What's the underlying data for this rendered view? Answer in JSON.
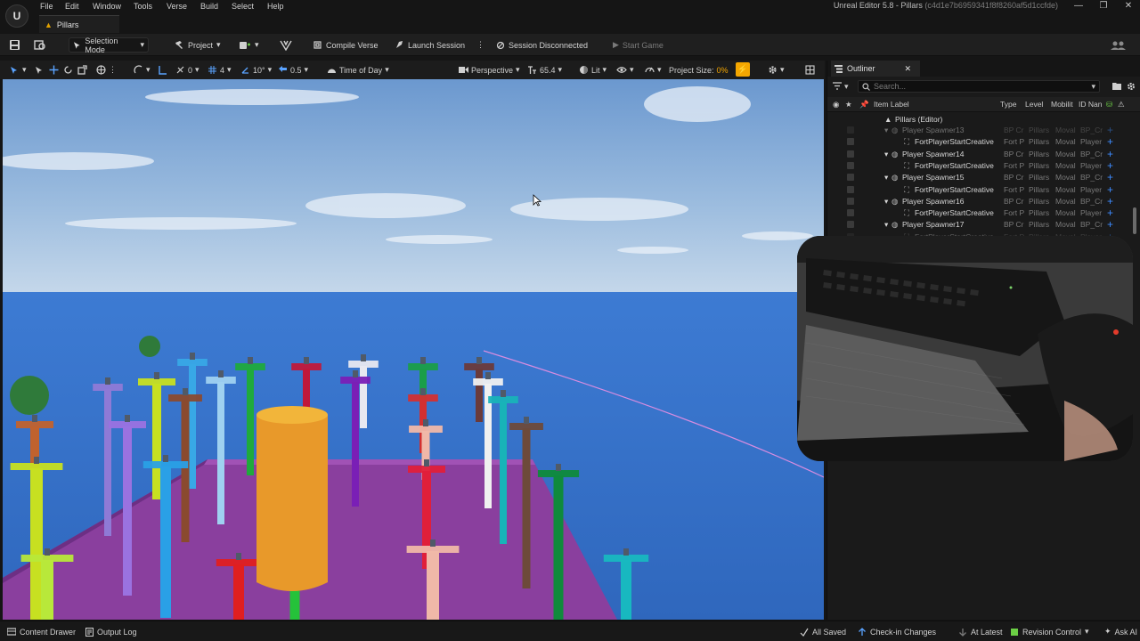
{
  "window": {
    "title": "Unreal Editor 5.8 - Pillars",
    "hash": "(c4d1e7b6959341f8f8260af5d1ccfde)",
    "controls": [
      "—",
      "❐",
      "✕"
    ]
  },
  "menu": [
    "File",
    "Edit",
    "Window",
    "Tools",
    "Verse",
    "Build",
    "Select",
    "Help"
  ],
  "doc_tab": "Pillars",
  "toolbar": {
    "selection_mode": "Selection Mode",
    "project": "Project",
    "compile_verse": "Compile Verse",
    "launch_session": "Launch Session",
    "session_status": "Session Disconnected",
    "start_game": "Start Game"
  },
  "viewport_toolbar": {
    "rot_snap": "0",
    "grid_count": "4",
    "angle_snap": "10°",
    "scale_snap": "0.5",
    "time_of_day": "Time of Day",
    "perspective": "Perspective",
    "fov": "65.4",
    "lit": "Lit",
    "project_size_label": "Project Size:",
    "project_size_value": "0%"
  },
  "outliner": {
    "tab": "Outliner",
    "search_placeholder": "Search...",
    "columns": [
      "Item Label",
      "Type",
      "Level",
      "Mobilit",
      "ID Nan"
    ],
    "root": "Pillars (Editor)",
    "rows": [
      {
        "label": "Player Spawner13",
        "indent": 1,
        "partial": true
      },
      {
        "label": "FortPlayerStartCreative",
        "indent": 2
      },
      {
        "label": "Player Spawner14",
        "indent": 1
      },
      {
        "label": "FortPlayerStartCreative",
        "indent": 2
      },
      {
        "label": "Player Spawner15",
        "indent": 1
      },
      {
        "label": "FortPlayerStartCreative",
        "indent": 2
      },
      {
        "label": "Player Spawner16",
        "indent": 1
      },
      {
        "label": "FortPlayerStartCreative",
        "indent": 2
      },
      {
        "label": "Player Spawner17",
        "indent": 1
      },
      {
        "label": "FortPlayerStartCreative",
        "indent": 2,
        "partial": true
      }
    ],
    "cells": {
      "spawner": [
        "BP Cr",
        "Pillars",
        "Moval",
        "BP_Cr"
      ],
      "start": [
        "Fort P",
        "Pillars",
        "Moval",
        "Player"
      ]
    }
  },
  "status_bar": {
    "content_drawer": "Content Drawer",
    "output_log": "Output Log",
    "all_saved": "All Saved",
    "check_in": "Check-in Changes",
    "at_latest": "At Latest",
    "revision_control": "Revision Control",
    "ask_ai": "Ask AI"
  },
  "colors": {
    "accent": "#f5a700",
    "plus": "#3d8bff",
    "sky_top": "#6f9bd2",
    "sea": "#3f7ed6",
    "floor": "#8a3f9e"
  }
}
